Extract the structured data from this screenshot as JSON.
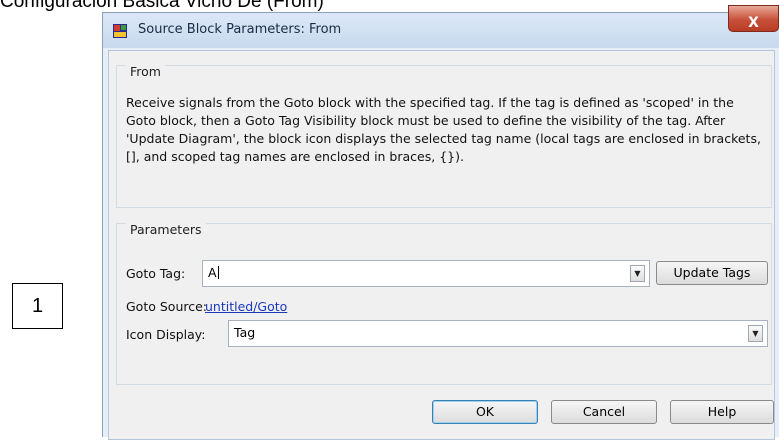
{
  "page": {
    "heading": "Configuración Básica Vicho De (From)",
    "number_box": "1"
  },
  "dialog": {
    "title": "Source Block Parameters: From",
    "close_glyph": "X",
    "from_section": {
      "label": "From",
      "description": "Receive signals from the Goto block with the specified tag.  If the tag is defined as 'scoped' in the Goto block, then a Goto Tag Visibility block must be used to define the visibility of the tag.  After 'Update Diagram', the block icon displays the selected tag name  (local tags are enclosed in brackets, [], and scoped tag names are enclosed in braces, {})."
    },
    "parameters_section": {
      "label": "Parameters",
      "goto_tag_label": "Goto Tag:",
      "goto_tag_value": "A",
      "update_tags_label": "Update Tags",
      "goto_source_label": "Goto Source:",
      "goto_source_link": "untitled/Goto",
      "icon_display_label": "Icon Display:",
      "icon_display_value": "Tag"
    },
    "buttons": {
      "ok": "OK",
      "cancel": "Cancel",
      "help": "Help"
    }
  },
  "icons": [
    "simulink-block-icon",
    "close-icon",
    "dropdown-arrow-icon"
  ]
}
